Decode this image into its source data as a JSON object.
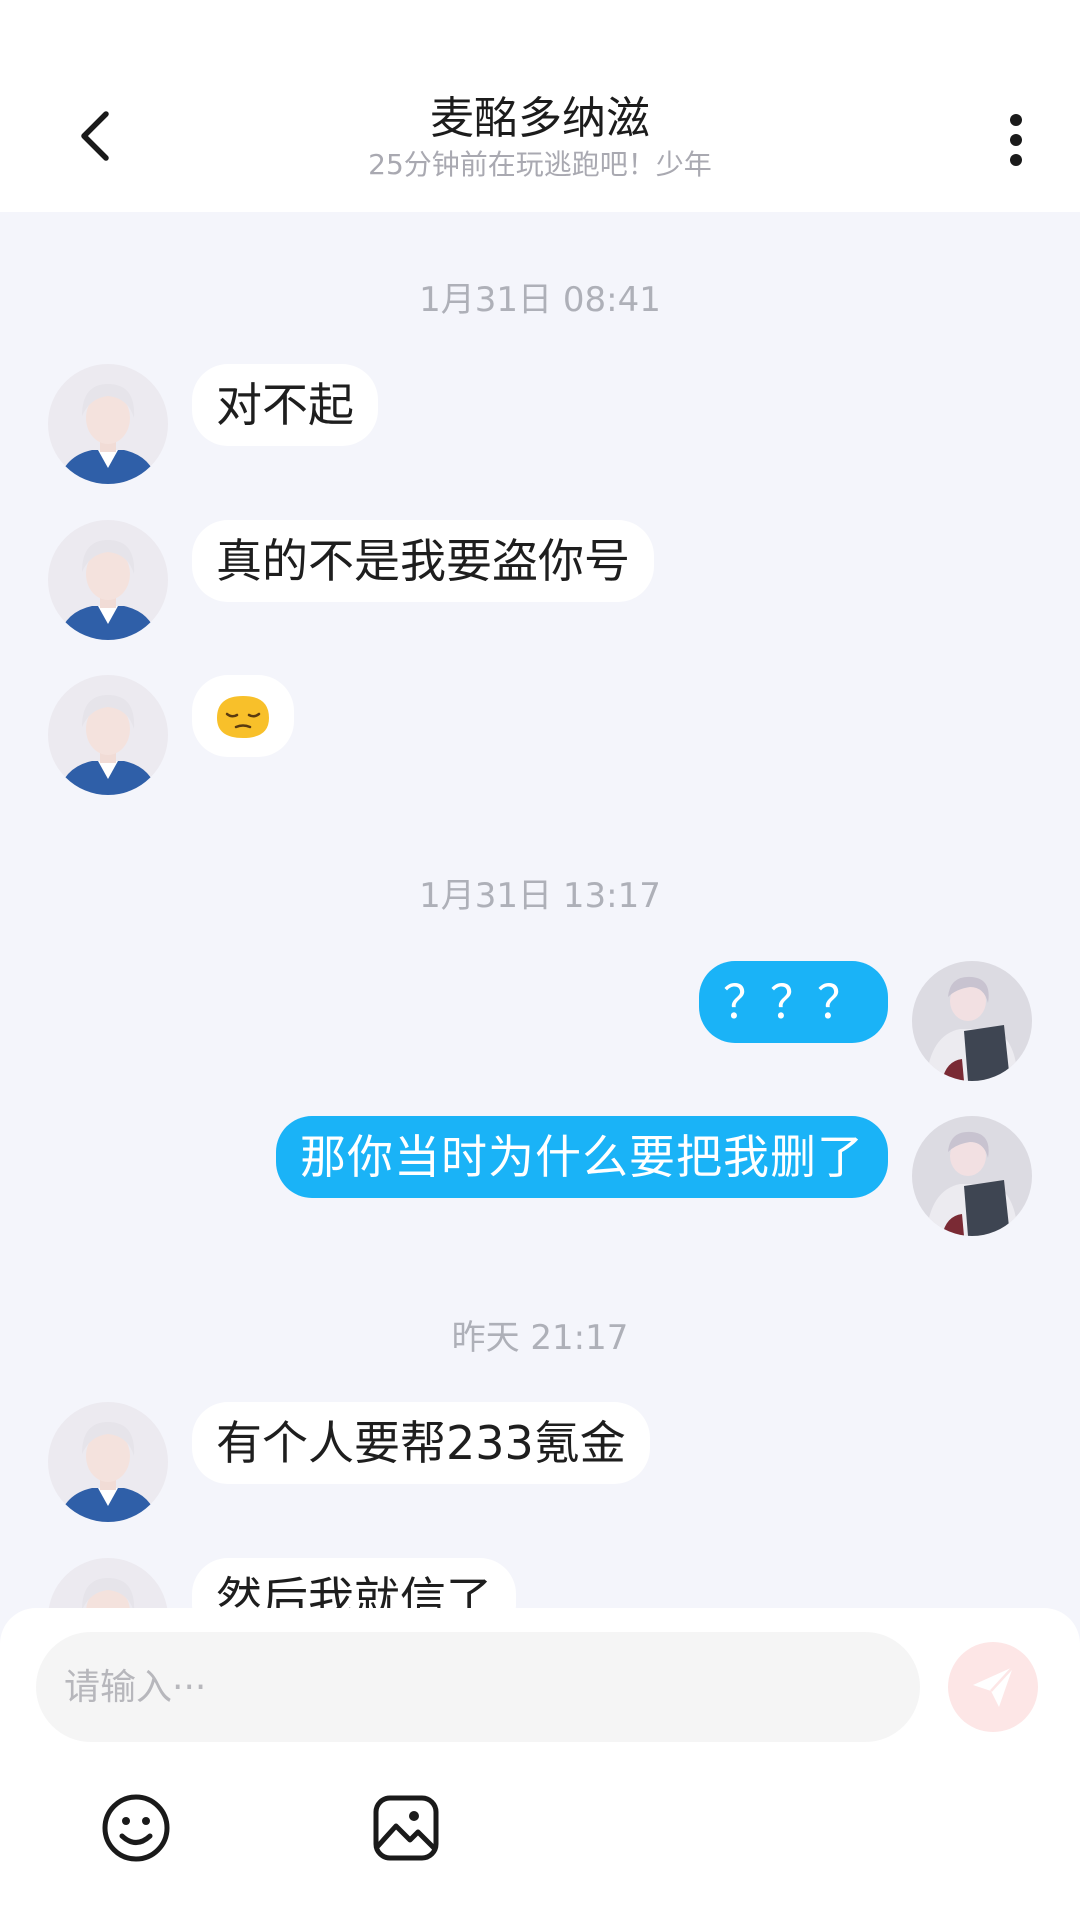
{
  "header": {
    "title": "麦酩多纳滋",
    "subtitle": "25分钟前在玩逃跑吧！少年",
    "back_icon": "chevron-left-icon",
    "more_icon": "more-vertical-icon"
  },
  "messages": [
    {
      "kind": "timestamp",
      "text": "1月31日 08:41"
    },
    {
      "kind": "incoming",
      "text": "对不起"
    },
    {
      "kind": "incoming",
      "text": "真的不是我要盗你号"
    },
    {
      "kind": "incoming",
      "emoji": "pensive-face-emoji"
    },
    {
      "kind": "timestamp",
      "text": "1月31日 13:17"
    },
    {
      "kind": "outgoing",
      "text": "？？？"
    },
    {
      "kind": "outgoing",
      "text": "那你当时为什么要把我删了"
    },
    {
      "kind": "timestamp",
      "text": "昨天 21:17"
    },
    {
      "kind": "incoming",
      "text": "有个人要帮233氪金"
    },
    {
      "kind": "incoming",
      "text": "然后我就信了"
    }
  ],
  "composer": {
    "placeholder": "请输入···",
    "send_icon": "send-paper-plane-icon",
    "emoji_icon": "smiley-icon",
    "image_icon": "image-icon"
  },
  "colors": {
    "outgoing_bubble": "#1ab3f7",
    "incoming_bubble": "#ffffff",
    "chat_background": "#f4f5fb",
    "send_button": "#fde6e6"
  }
}
